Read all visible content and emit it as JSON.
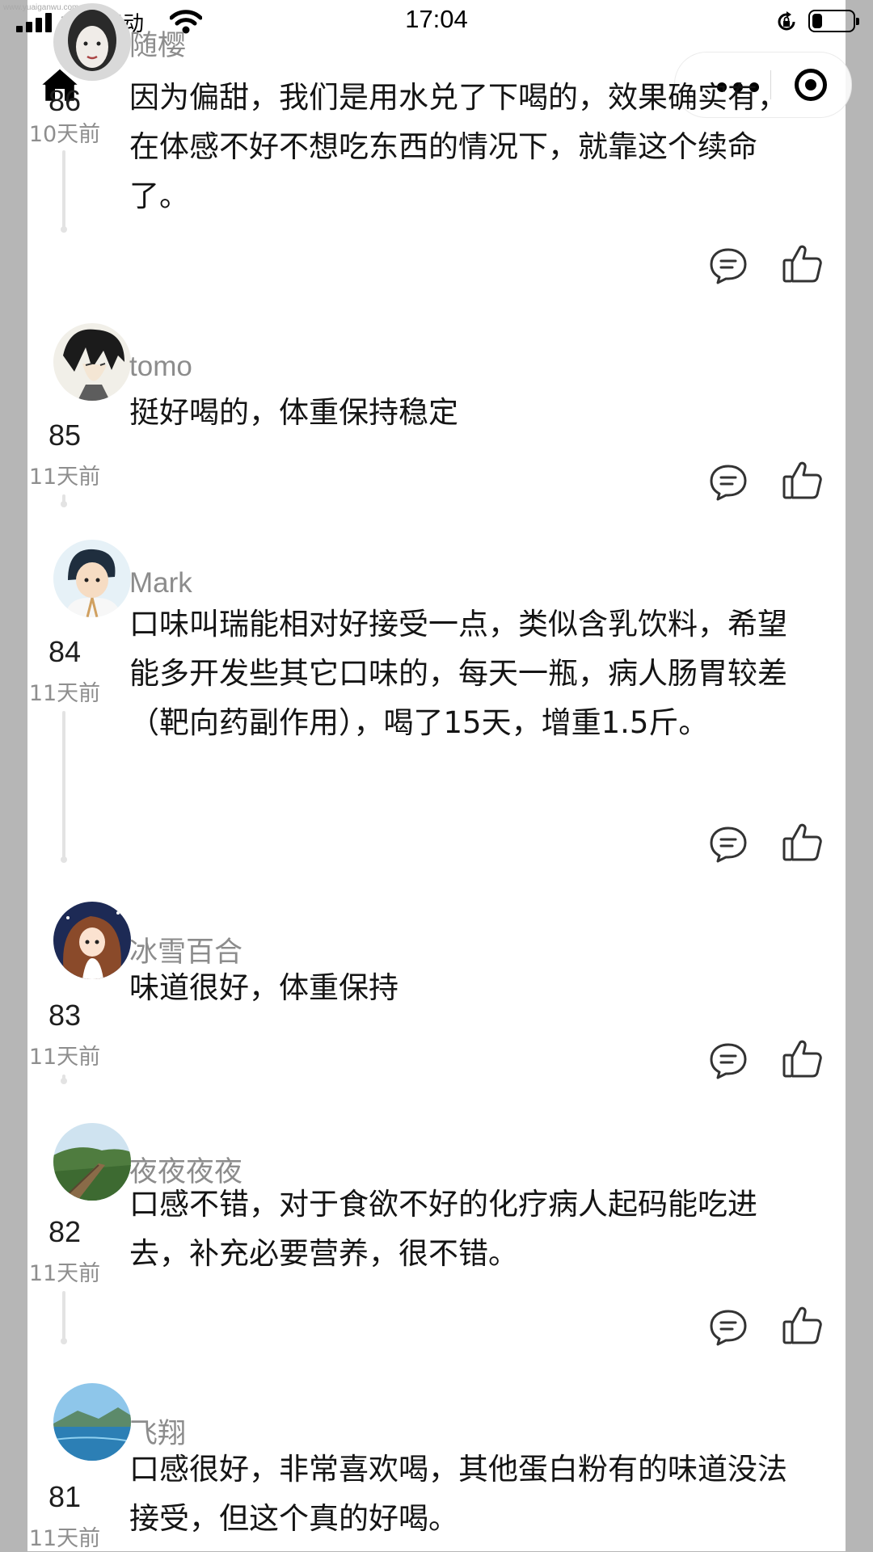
{
  "status_bar": {
    "watermark": "www.yuaiganwu.com",
    "carrier": "中国移动",
    "time": "17:04",
    "battery_level": 0.25
  },
  "navigation": {
    "home_icon": "home-icon",
    "more_icon": "more-dots-icon",
    "close_icon": "target-icon"
  },
  "comments": [
    {
      "author": "随樱",
      "score": "86",
      "time": "10天前",
      "text": "因为偏甜，我们是用水兑了下喝的，效果确实有，在体感不好不想吃东西的情况下，就靠这个续命了。",
      "avatar": "avatar-woman-portrait"
    },
    {
      "author": "tomo",
      "score": "85",
      "time": "11天前",
      "text": "挺好喝的，体重保持稳定",
      "avatar": "avatar-anime-boy"
    },
    {
      "author": "Mark",
      "score": "84",
      "time": "11天前",
      "text": "口味叫瑞能相对好接受一点，类似含乳饮料，希望能多开发些其它口味的，每天一瓶，病人肠胃较差（靶向药副作用），喝了15天，增重1.5斤。",
      "avatar": "avatar-cartoon-man"
    },
    {
      "author": "冰雪百合",
      "score": "83",
      "time": "11天前",
      "text": "味道很好，体重保持",
      "avatar": "avatar-cartoon-girl"
    },
    {
      "author": "夜夜夜夜",
      "score": "82",
      "time": "11天前",
      "text": "口感不错，对于食欲不好的化疗病人起码能吃进去，补充必要营养，很不错。",
      "avatar": "avatar-boardwalk-photo"
    },
    {
      "author": "飞翔",
      "score": "81",
      "time": "11天前",
      "text": "口感很好，非常喜欢喝，其他蛋白粉有的味道没法接受，但这个真的好喝。",
      "avatar": "avatar-lake-photo"
    }
  ],
  "actions": {
    "reply_icon": "comment-bubble-icon",
    "like_icon": "thumbs-up-icon"
  },
  "colors": {
    "background": "#b6b6b6",
    "panel": "#ffffff",
    "author": "#8c8c8c",
    "text": "#141414",
    "meta": "#8e8e8e"
  }
}
